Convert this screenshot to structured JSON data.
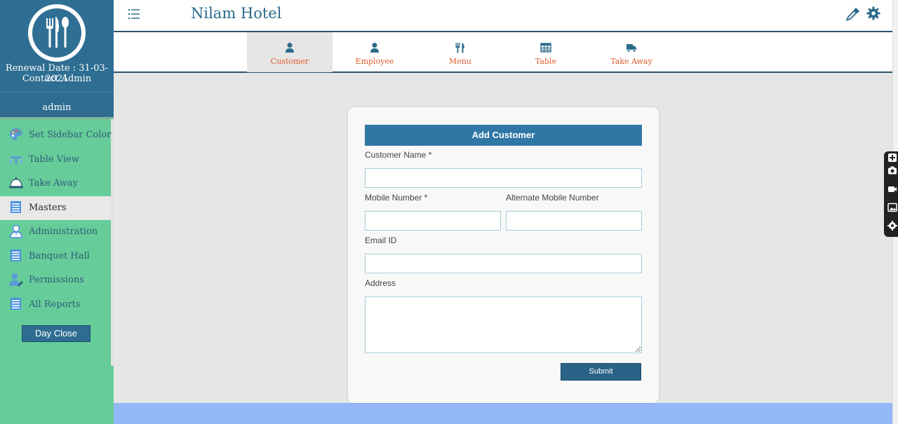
{
  "app": {
    "title": "Nilam Hotel"
  },
  "sidebar": {
    "renewal": "Renewal Date : 31-03-2021",
    "contact": "Contact Admin",
    "user": "admin",
    "items": [
      {
        "label": "Set Sidebar Color",
        "icon": "palette-icon"
      },
      {
        "label": "Table View",
        "icon": "table-view-icon"
      },
      {
        "label": "Take Away",
        "icon": "bell-icon"
      },
      {
        "label": "Masters",
        "icon": "list-icon",
        "active": true
      },
      {
        "label": "Administration",
        "icon": "admin-user-icon"
      },
      {
        "label": "Banquet Hall",
        "icon": "list-icon"
      },
      {
        "label": "Permissions",
        "icon": "user-edit-icon"
      },
      {
        "label": "All Reports",
        "icon": "list-icon"
      }
    ],
    "day_close": "Day Close"
  },
  "tabs": [
    {
      "label": "Customer",
      "icon": "user-icon",
      "active": true
    },
    {
      "label": "Employee",
      "icon": "user-icon"
    },
    {
      "label": "Menu",
      "icon": "utensils-icon"
    },
    {
      "label": "Table",
      "icon": "table-icon"
    },
    {
      "label": "Take Away",
      "icon": "truck-icon"
    }
  ],
  "form": {
    "title": "Add Customer",
    "customer_name_label": "Customer Name *",
    "mobile_label": "Mobile Number *",
    "alt_mobile_label": "Alternate Mobile Number",
    "email_label": "Email ID",
    "address_label": "Address",
    "customer_name_value": "",
    "mobile_value": "",
    "alt_mobile_value": "",
    "email_value": "",
    "address_value": "",
    "submit_label": "Submit"
  },
  "colors": {
    "sidebar_green": "#66cc99",
    "sidebar_blue": "#2f6f93",
    "tab_label": "#e05a2b",
    "form_header": "#2f77a5",
    "bottom_bar": "#93b8f5"
  }
}
